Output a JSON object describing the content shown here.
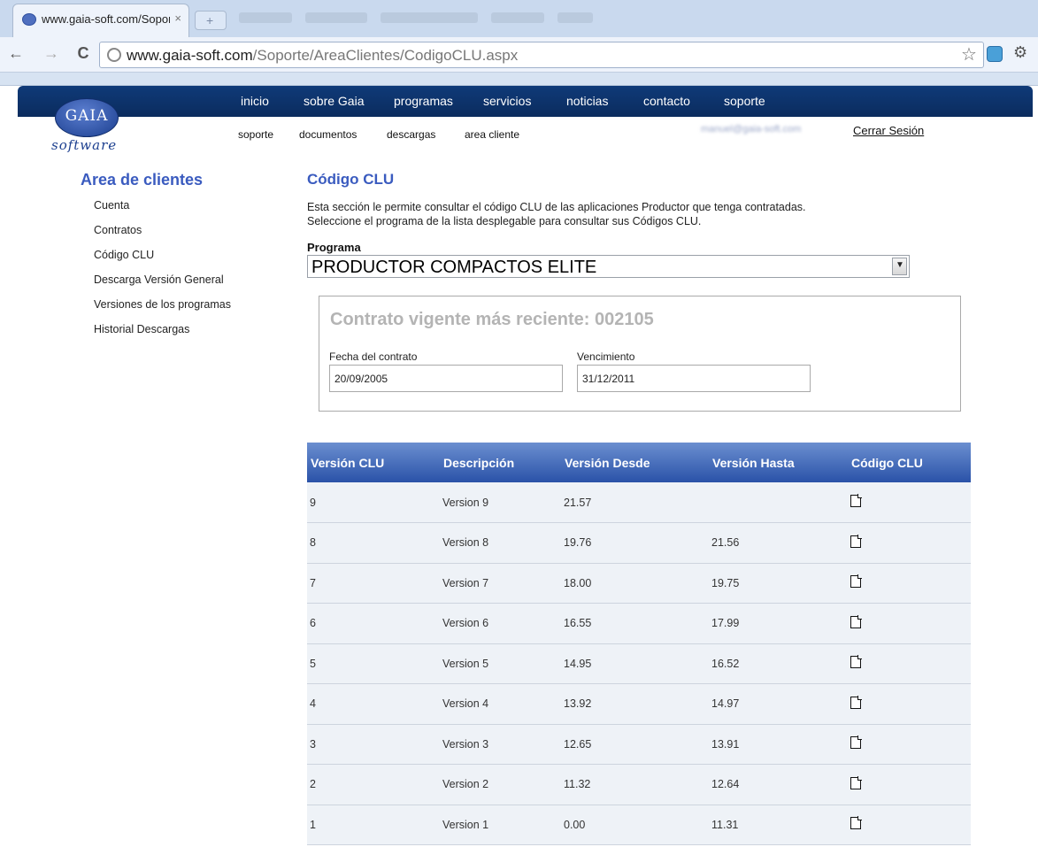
{
  "browser": {
    "tab_title": "www.gaia-soft.com/Soport",
    "tab_close": "×",
    "new_tab": "+",
    "url_host": "www.gaia-soft.com",
    "url_path": "/Soporte/AreaClientes/CodigoCLU.aspx",
    "back_glyph": "←",
    "forward_glyph": "→",
    "reload_glyph": "C",
    "star_glyph": "☆",
    "wrench_glyph": "🔧"
  },
  "header": {
    "logo_text": "GAIA",
    "logo_sub": "software",
    "main_nav": [
      "inicio",
      "sobre Gaia",
      "programas",
      "servicios",
      "noticias",
      "contacto",
      "soporte"
    ],
    "sub_nav": [
      "soporte",
      "documentos",
      "descargas",
      "area cliente"
    ],
    "user_email": "manuel@gaia-soft.com",
    "logout": "Cerrar Sesión"
  },
  "sidebar": {
    "title": "Area de clientes",
    "items": [
      {
        "label": "Cuenta"
      },
      {
        "label": "Contratos"
      },
      {
        "label": "Código CLU"
      },
      {
        "label": "Descarga Versión General"
      },
      {
        "label": "Versiones de los programas"
      },
      {
        "label": "Historial Descargas"
      }
    ]
  },
  "main": {
    "title": "Código CLU",
    "intro_line1": "Esta sección le permite consultar el código CLU de las aplicaciones Productor que tenga contratadas.",
    "intro_line2": "Seleccione el programa de la lista desplegable para consultar sus Códigos CLU.",
    "program_label": "Programa",
    "program_selected": "PRODUCTOR COMPACTOS ELITE",
    "contract": {
      "title": "Contrato vigente más reciente: 002105",
      "date_label": "Fecha del contrato",
      "date_value": "20/09/2005",
      "expiry_label": "Vencimiento",
      "expiry_value": "31/12/2011"
    },
    "table": {
      "headers": [
        "Versión CLU",
        "Descripción",
        "Versión Desde",
        "Versión Hasta",
        "Código CLU"
      ],
      "rows": [
        {
          "version": "9",
          "description": "Version 9",
          "from": "21.57",
          "to": ""
        },
        {
          "version": "8",
          "description": "Version 8",
          "from": "19.76",
          "to": "21.56"
        },
        {
          "version": "7",
          "description": "Version 7",
          "from": "18.00",
          "to": "19.75"
        },
        {
          "version": "6",
          "description": "Version 6",
          "from": "16.55",
          "to": "17.99"
        },
        {
          "version": "5",
          "description": "Version 5",
          "from": "14.95",
          "to": "16.52"
        },
        {
          "version": "4",
          "description": "Version 4",
          "from": "13.92",
          "to": "14.97"
        },
        {
          "version": "3",
          "description": "Version 3",
          "from": "12.65",
          "to": "13.91"
        },
        {
          "version": "2",
          "description": "Version 2",
          "from": "11.32",
          "to": "12.64"
        },
        {
          "version": "1",
          "description": "Version 1",
          "from": "0.00",
          "to": "11.31"
        }
      ]
    }
  }
}
